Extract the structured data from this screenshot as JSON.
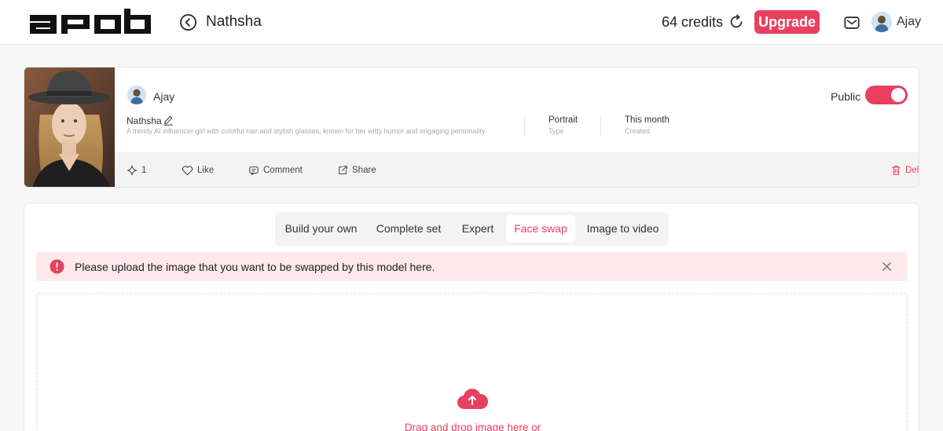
{
  "header": {
    "logo_text": "apob",
    "page_title": "Nathsha",
    "credits": "64 credits",
    "upgrade_label": "Upgrade",
    "user_name": "Ajay"
  },
  "model_card": {
    "owner_name": "Ajay",
    "model_name": "Nathsha",
    "description": "A trendy AI influencer girl with colorful hair and stylish glasses, known for her witty humor and engaging personality.",
    "type_value": "Portrait",
    "type_label": "Type",
    "created_value": "This month",
    "created_label": "Created",
    "public_label": "Public",
    "public_enabled": true,
    "actions": {
      "sparkle_count": "1",
      "like": "Like",
      "comment": "Comment",
      "share": "Share",
      "delete": "Delete"
    }
  },
  "tabs": [
    {
      "label": "Build your own",
      "active": false
    },
    {
      "label": "Complete set",
      "active": false
    },
    {
      "label": "Expert",
      "active": false
    },
    {
      "label": "Face swap",
      "active": true
    },
    {
      "label": "Image to video",
      "active": false
    }
  ],
  "alert": {
    "text": "Please upload the image that you want to be swapped by this model here."
  },
  "dropzone": {
    "text": "Drag and drop image here or"
  },
  "colors": {
    "accent": "#e9405f",
    "alert_bg": "#fde8ec"
  }
}
